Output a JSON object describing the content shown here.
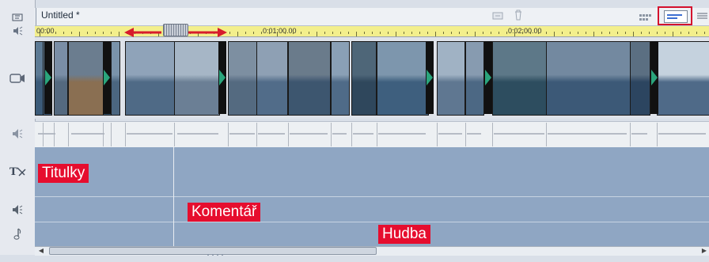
{
  "window": {
    "title": "Untitled *"
  },
  "ruler": {
    "timecodes": [
      "00:00",
      "0:01:00.00",
      "0:02:00.00"
    ]
  },
  "tracks": {
    "titles_label": "Titulky",
    "voice_label": "Komentář",
    "music_label": "Hudba"
  },
  "icons": {
    "header_left": "timeline-view-icon",
    "ruler_left": "speaker-icon",
    "video_track": "video-camera-icon",
    "audio_track": "speaker-icon",
    "titles_track": "title-text-icon",
    "voice_track": "microphone-speaker-icon",
    "music_track": "music-note-icon",
    "storyboard_view": "storyboard-view-icon",
    "timeline_view": "timeline-view-icon",
    "text_view": "text-list-view-icon",
    "delete": "trash-icon",
    "split": "split-clip-icon"
  },
  "colors": {
    "annotation": "#e60d2e",
    "ruler": "#f3ef8c",
    "track_fill": "#8fa6c3",
    "transition": "#2aa57c",
    "selected_view_border": "#d4102e"
  }
}
